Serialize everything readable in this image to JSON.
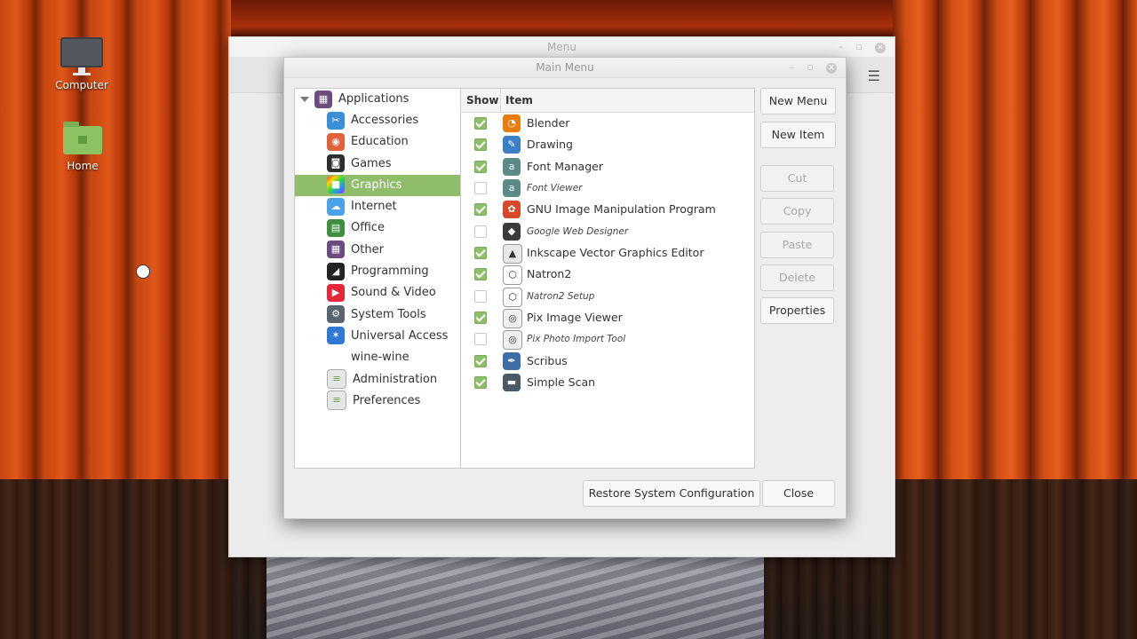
{
  "desktop": {
    "icons": [
      {
        "label": "Computer"
      },
      {
        "label": "Home"
      }
    ]
  },
  "back_window": {
    "title": "Menu"
  },
  "main_window": {
    "title": "Main Menu"
  },
  "tree": {
    "root": "Applications",
    "categories": [
      {
        "label": "Accessories",
        "icon": "scissors-icon",
        "color": "#3a8fd6"
      },
      {
        "label": "Education",
        "icon": "education-icon",
        "color": "#e0623a"
      },
      {
        "label": "Games",
        "icon": "gamepad-icon",
        "color": "#2d2d2d"
      },
      {
        "label": "Graphics",
        "icon": "graphics-icon",
        "color": "#c026d3",
        "selected": true
      },
      {
        "label": "Internet",
        "icon": "cloud-icon",
        "color": "#4aa3e8"
      },
      {
        "label": "Office",
        "icon": "office-icon",
        "color": "#3f8f3f"
      },
      {
        "label": "Other",
        "icon": "grid-icon",
        "color": "#6b4c7e"
      },
      {
        "label": "Programming",
        "icon": "programming-icon",
        "color": "#222222"
      },
      {
        "label": "Sound & Video",
        "icon": "play-icon",
        "color": "#e2283b"
      },
      {
        "label": "System Tools",
        "icon": "gear-icon",
        "color": "#5a6470"
      },
      {
        "label": "Universal Access",
        "icon": "accessibility-icon",
        "color": "#2f78d4"
      },
      {
        "label": "wine-wine",
        "icon": "",
        "color": ""
      },
      {
        "label": "Administration",
        "icon": "admin-icon",
        "color": "#e6e6e6"
      },
      {
        "label": "Preferences",
        "icon": "preferences-icon",
        "color": "#e6e6e6"
      }
    ]
  },
  "list": {
    "header_show": "Show",
    "header_item": "Item",
    "items": [
      {
        "name": "Blender",
        "shown": true,
        "icon": "blender-icon",
        "color": "#e87d0d"
      },
      {
        "name": "Drawing",
        "shown": true,
        "icon": "drawing-icon",
        "color": "#3d7fc7"
      },
      {
        "name": "Font Manager",
        "shown": true,
        "icon": "font-icon",
        "color": "#5b8c86"
      },
      {
        "name": "Font Viewer",
        "shown": false,
        "icon": "font-icon",
        "color": "#5b8c86"
      },
      {
        "name": "GNU Image Manipulation Program",
        "shown": true,
        "icon": "gimp-icon",
        "color": "#d64a2b"
      },
      {
        "name": "Google Web Designer",
        "shown": false,
        "icon": "gwd-icon",
        "color": "#3a3a3a"
      },
      {
        "name": "Inkscape Vector Graphics Editor",
        "shown": true,
        "icon": "inkscape-icon",
        "color": "#e8e8e8"
      },
      {
        "name": "Natron2",
        "shown": true,
        "icon": "natron-icon",
        "color": "#ffffff"
      },
      {
        "name": "Natron2 Setup",
        "shown": false,
        "icon": "natron-icon",
        "color": "#ffffff"
      },
      {
        "name": "Pix Image Viewer",
        "shown": true,
        "icon": "pix-icon",
        "color": "#f0f0f0"
      },
      {
        "name": "Pix Photo Import Tool",
        "shown": false,
        "icon": "pix-icon",
        "color": "#f0f0f0"
      },
      {
        "name": "Scribus",
        "shown": true,
        "icon": "scribus-icon",
        "color": "#3e6fa8"
      },
      {
        "name": "Simple Scan",
        "shown": true,
        "icon": "scanner-icon",
        "color": "#4a5a66"
      }
    ]
  },
  "buttons": {
    "new_menu": "New Menu",
    "new_item": "New Item",
    "cut": "Cut",
    "copy": "Copy",
    "paste": "Paste",
    "delete": "Delete",
    "properties": "Properties",
    "restore": "Restore System Configuration",
    "close": "Close"
  }
}
